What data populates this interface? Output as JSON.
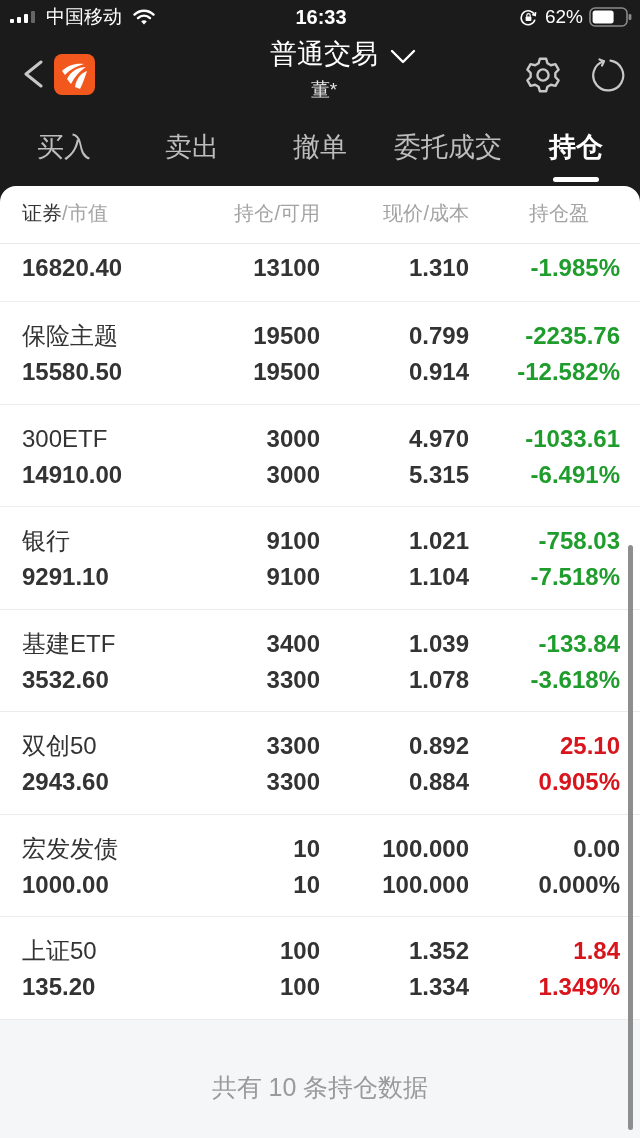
{
  "status_bar": {
    "carrier": "中国移动",
    "time": "16:33",
    "battery": "62%"
  },
  "header": {
    "title": "普通交易",
    "subtitle": "董*"
  },
  "tabs": [
    {
      "label": "买入",
      "selected": false
    },
    {
      "label": "卖出",
      "selected": false
    },
    {
      "label": "撤单",
      "selected": false
    },
    {
      "label": "委托成交",
      "selected": false
    },
    {
      "label": "持仓",
      "selected": true
    }
  ],
  "table": {
    "columns": [
      {
        "label": "**证券**/市值"
      },
      {
        "label": "持仓/可用"
      },
      {
        "label": "现价/成本"
      },
      {
        "label": "持仓盈"
      }
    ],
    "rows": [
      {
        "market_value": "16820.40",
        "available": "13100",
        "cost": "1.310",
        "pnl_pct": "-1.985%",
        "color": "#1f9d2c"
      },
      {
        "name": "保险主题",
        "quantity": "19500",
        "price": "0.799",
        "pnl": "-2235.76",
        "market_value": "15580.50",
        "available": "19500",
        "cost": "0.914",
        "pnl_pct": "-12.582%",
        "color": "#1f9d2c"
      },
      {
        "name": "300ETF",
        "quantity": "3000",
        "price": "4.970",
        "pnl": "-1033.61",
        "market_value": "14910.00",
        "available": "3000",
        "cost": "5.315",
        "pnl_pct": "-6.491%",
        "color": "#1f9d2c"
      },
      {
        "name": "银行",
        "quantity": "9100",
        "price": "1.021",
        "pnl": "-758.03",
        "market_value": "9291.10",
        "available": "9100",
        "cost": "1.104",
        "pnl_pct": "-7.518%",
        "color": "#1f9d2c"
      },
      {
        "name": "基建ETF",
        "quantity": "3400",
        "price": "1.039",
        "pnl": "-133.84",
        "market_value": "3532.60",
        "available": "3300",
        "cost": "1.078",
        "pnl_pct": "-3.618%",
        "color": "#1f9d2c"
      },
      {
        "name": "双创50",
        "quantity": "3300",
        "price": "0.892",
        "pnl": "25.10",
        "market_value": "2943.60",
        "available": "3300",
        "cost": "0.884",
        "pnl_pct": "0.905%",
        "color": "#d8141d"
      },
      {
        "name": "宏发发债",
        "quantity": "10",
        "price": "100.000",
        "pnl": "0.00",
        "market_value": "1000.00",
        "available": "10",
        "cost": "100.000",
        "pnl_pct": "0.000%",
        "color": "#333333"
      },
      {
        "name": "上证50",
        "quantity": "100",
        "price": "1.352",
        "pnl": "1.84",
        "market_value": "135.20",
        "available": "100",
        "cost": "1.334",
        "pnl_pct": "1.349%",
        "color": "#d8141d"
      }
    ]
  },
  "footer": {
    "summary": "共有 10 条持仓数据"
  }
}
